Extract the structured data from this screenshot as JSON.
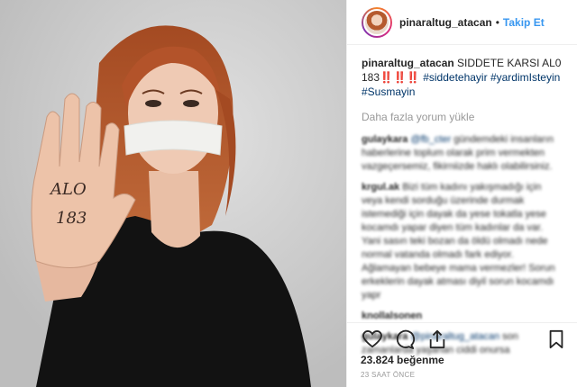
{
  "post": {
    "username": "pinaraltug_atacan",
    "follow_label": "Takip Et",
    "dot": "•",
    "caption_text": "SIDDETE KARSI AL0",
    "caption_number": "183",
    "caption_pale": "‼️‼️‼️",
    "tags": [
      "#siddetehayir",
      "#yardimIsteyin",
      "#Susmayin"
    ],
    "load_more": "Daha fazla yorum yükle",
    "likes": "23.824 beğenme",
    "time": "23 SAAT ÖNCE",
    "hand_text": [
      "ALO",
      "183"
    ]
  },
  "comments": [
    {
      "user": "gulaykara",
      "mention": "@fb_cter",
      "text": "gündemdeki insanların haberlerine toplum olarak prim vermekten vazgeçersemiz, fikirniizde haklı olabilirsiniz."
    },
    {
      "user": "krgul.ak",
      "mention": "",
      "text": "Bizi tüm kadını yakışmadığı için veya kendi sorduğu üzerinde durmak istemediği için dayak da yese tokatla yese kocamdı yapar diyen tüm kadınlar da var. Yani sasın teki bozan da öldü olmadı nede normal vatanda olmadı fark ediyor. Ağlamayan bebeye mama vermezler! Sorun erkeklerin dayak atması diyil sorun kocamdı yapr"
    },
    {
      "user": "knollalsonen",
      "mention": "",
      "text": ""
    },
    {
      "user": "gulaykara",
      "mention": "@pinaraltug_atacan",
      "text": "son zamanlarda yaşanan ciddi onursa"
    }
  ],
  "colors": {
    "link": "#003569",
    "follow": "#3897f0",
    "meta": "#999999"
  },
  "icons": [
    "heart-icon",
    "comment-icon",
    "share-icon",
    "bookmark-icon"
  ]
}
